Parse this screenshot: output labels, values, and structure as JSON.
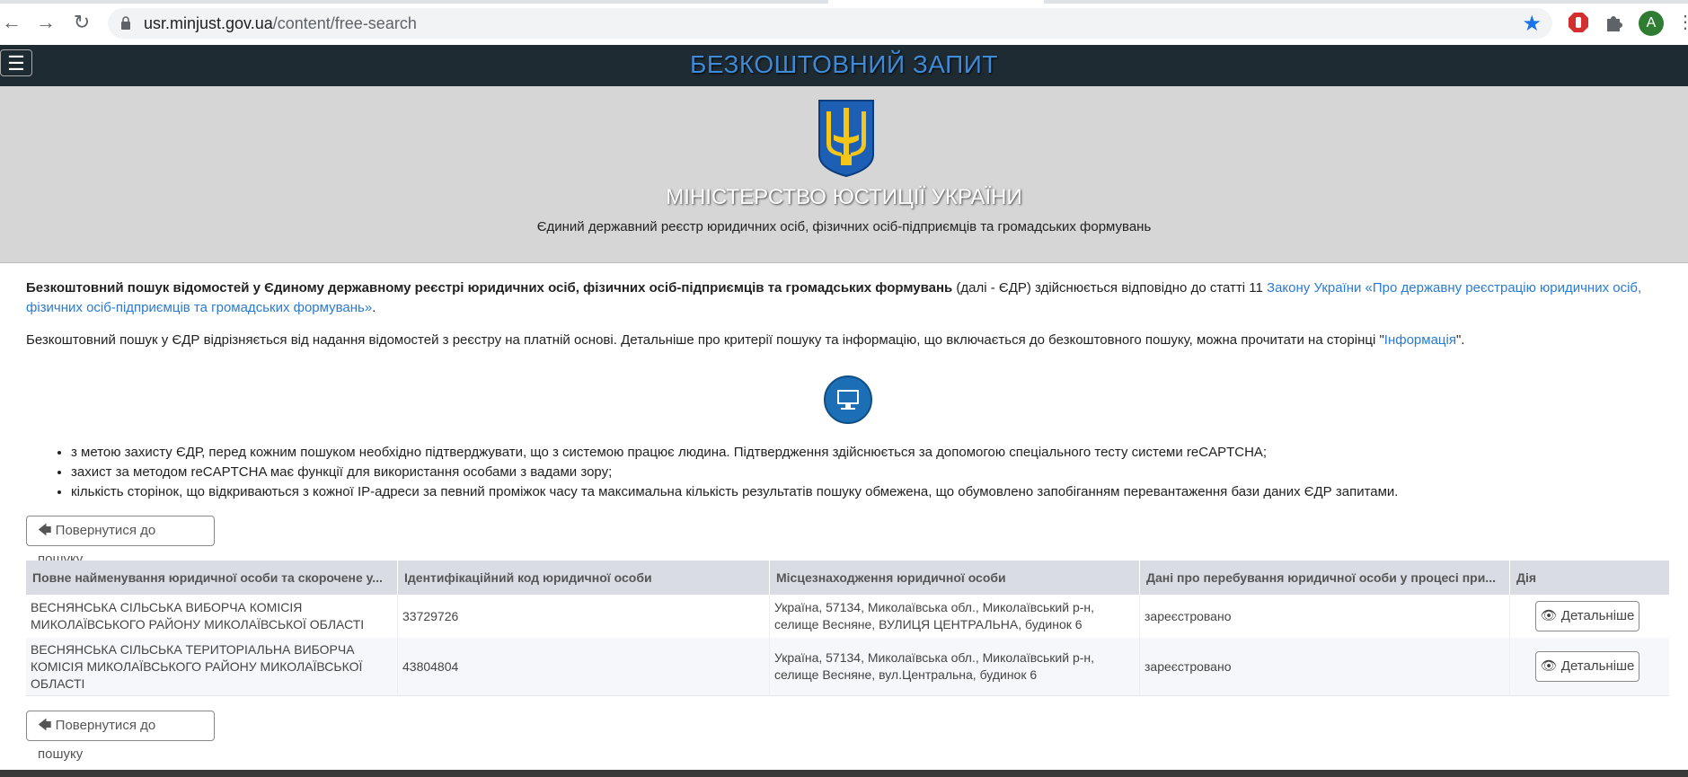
{
  "browser": {
    "url_host": "usr.minjust.gov.ua",
    "url_path": "/content/free-search",
    "avatar_letter": "A"
  },
  "topbar": {
    "title": "БЕЗКОШТОВНИЙ ЗАПИТ",
    "menu_icon": "☰"
  },
  "header": {
    "ministry": "МІНІСТЕРСТВО ЮСТИЦІЇ УКРАЇНИ",
    "register": "Єдиний державний реєстр юридичних осіб, фізичних осіб-підприємців та громадських формувань"
  },
  "intro": {
    "bold": "Безкоштовний пошук відомостей у Єдиному державному реєстрі юридичних осіб, фізичних осіб-підприємців та громадських формувань",
    "middle": " (далі - ЄДР) здійснюється відповідно до статті 11 ",
    "law_link": "Закону України «Про державну реєстрацію юридичних осіб, фізичних осіб-підприємців та громадських формувань»",
    "end": "."
  },
  "note": {
    "text": "Безкоштовний пошук у ЄДР відрізняється від надання відомостей з реєстру на платній основі. Детальніше про критерії пошуку та інформацію, що включається до безкоштовного пошуку, можна прочитати на сторінці \"",
    "link": "Інформація",
    "end": "\"."
  },
  "bullets": [
    "з метою захисту ЄДР, перед кожним пошуком необхідно підтверджувати, що з системою працює людина. Підтвердження здійснюється за допомогою спеціального тесту системи reCAPTCHA;",
    "захист за методом reCAPTCHA має функції для використання особами з вадами зору;",
    "кількість сторінок, що відкриваються з кожної IP-адреси за певний проміжок часу та максимальна кількість результатів пошуку обмежена, що обумовлено запобіганням перевантаження бази даних ЄДР запитами."
  ],
  "back_button": "Повернутися до пошуку",
  "table": {
    "headers": [
      "Повне найменування юридичної особи та скорочене у...",
      "Ідентифікаційний код юридичної особи",
      "Місцезнаходження юридичної особи",
      "Дані про перебування юридичної особи у процесі при...",
      "Дія"
    ],
    "rows": [
      {
        "name": "ВЕСНЯНСЬКА СІЛЬСЬКА ВИБОРЧА КОМІСІЯ МИКОЛАЇВСЬКОГО РАЙОНУ МИКОЛАЇВСЬКОЇ ОБЛАСТІ",
        "code": "33729726",
        "address": "Україна, 57134, Миколаївська обл., Миколаївський р-н, селище Весняне, ВУЛИЦЯ ЦЕНТРАЛЬНА, будинок 6",
        "status": "зареєстровано",
        "action": "Детальніше"
      },
      {
        "name": "ВЕСНЯНСЬКА СІЛЬСЬКА ТЕРИТОРІАЛЬНА ВИБОРЧА КОМІСІЯ МИКОЛАЇВСЬКОГО РАЙОНУ МИКОЛАЇВСЬКОЇ ОБЛАСТІ",
        "code": "43804804",
        "address": "Україна, 57134, Миколаївська обл., Миколаївський р-н, селище Весняне, вул.Центральна, будинок 6",
        "status": "зареєстровано",
        "action": "Детальніше"
      }
    ]
  }
}
